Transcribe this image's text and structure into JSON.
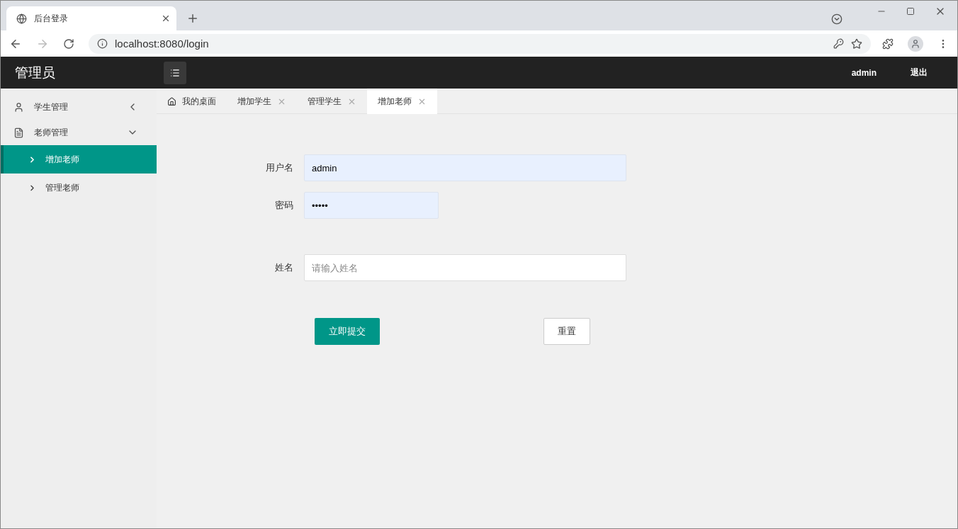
{
  "browser": {
    "tab_title": "后台登录",
    "url": "localhost:8080/login"
  },
  "header": {
    "title": "管理员",
    "user": "admin",
    "logout": "退出"
  },
  "sidebar": {
    "items": [
      {
        "label": "学生管理",
        "kind": "user",
        "expanded": false
      },
      {
        "label": "老师管理",
        "kind": "folder",
        "expanded": true,
        "children": [
          {
            "label": "增加老师",
            "selected": true
          },
          {
            "label": "管理老师",
            "selected": false
          }
        ]
      }
    ]
  },
  "tabs": [
    {
      "label": "我的桌面",
      "kind": "home",
      "selected": false
    },
    {
      "label": "增加学生",
      "kind": "closable",
      "selected": false
    },
    {
      "label": "管理学生",
      "kind": "closable",
      "selected": false
    },
    {
      "label": "增加老师",
      "kind": "closable",
      "selected": true
    }
  ],
  "form": {
    "fields": [
      {
        "label": "用户名",
        "value": "admin",
        "kind": "text",
        "autofilled": true
      },
      {
        "label": "密码",
        "value": "•••••",
        "kind": "password",
        "autofilled": true
      },
      {
        "label": "姓名",
        "placeholder": "请输入姓名",
        "kind": "text",
        "autofilled": false
      }
    ],
    "submit": "立即提交",
    "reset": "重置"
  }
}
